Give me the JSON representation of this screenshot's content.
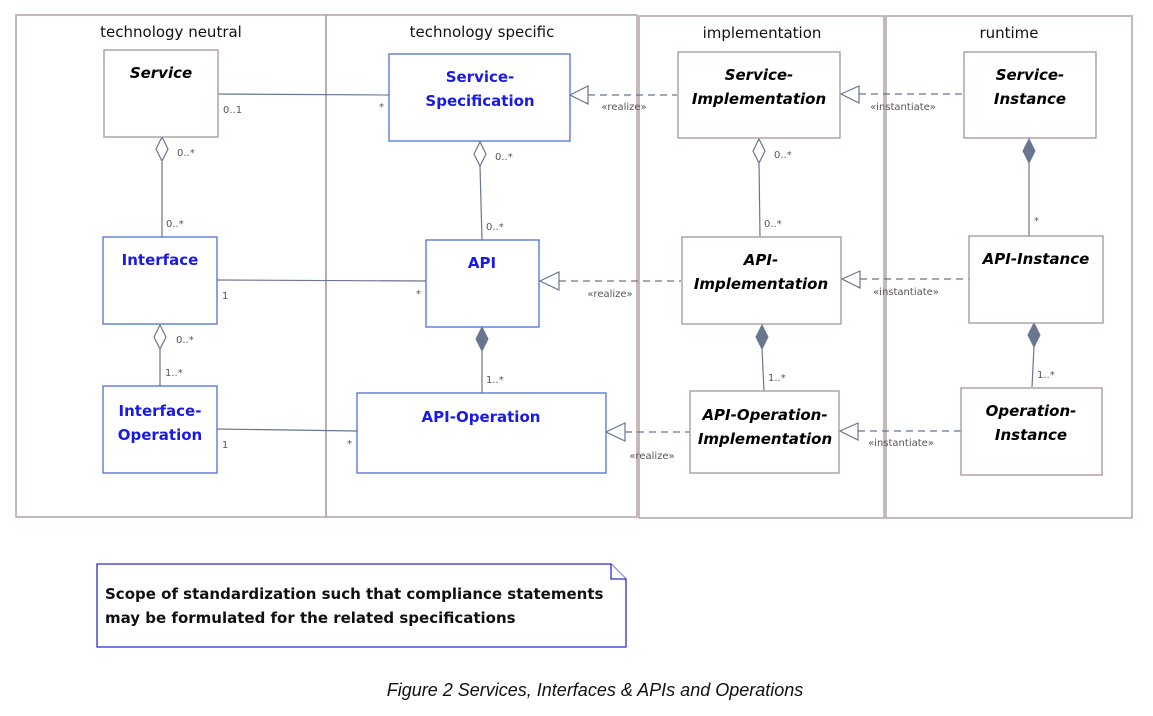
{
  "swimlanes": [
    {
      "title": "technology neutral"
    },
    {
      "title": "technology specific"
    },
    {
      "title": "implementation"
    },
    {
      "title": "runtime"
    }
  ],
  "classes": {
    "service": {
      "name_lines": [
        "Service"
      ],
      "style": "italic"
    },
    "interface": {
      "name_lines": [
        "Interface"
      ],
      "style": "blue"
    },
    "interface_operation": {
      "name_lines": [
        "Interface-",
        "Operation"
      ],
      "style": "blue"
    },
    "service_specification": {
      "name_lines": [
        "Service-",
        "Specification"
      ],
      "style": "blue"
    },
    "api": {
      "name_lines": [
        "API"
      ],
      "style": "blue"
    },
    "api_operation": {
      "name_lines": [
        "API-Operation"
      ],
      "style": "blue"
    },
    "service_implementation": {
      "name_lines": [
        "Service-",
        "Implementation"
      ],
      "style": "italic"
    },
    "api_implementation": {
      "name_lines": [
        "API-",
        "Implementation"
      ],
      "style": "italic"
    },
    "api_operation_implementation": {
      "name_lines": [
        "API-Operation-",
        "Implementation"
      ],
      "style": "italic"
    },
    "service_instance": {
      "name_lines": [
        "Service-",
        "Instance"
      ],
      "style": "italic"
    },
    "api_instance": {
      "name_lines": [
        "API-Instance"
      ],
      "style": "italic"
    },
    "operation_instance": {
      "name_lines": [
        "Operation-",
        "Instance"
      ],
      "style": "italic"
    }
  },
  "relations": {
    "service_to_spec": {
      "type": "association",
      "source_mult": "0..1",
      "target_mult": "*"
    },
    "interface_to_api": {
      "type": "association",
      "source_mult": "1",
      "target_mult": "*"
    },
    "ifop_to_apiop": {
      "type": "association",
      "source_mult": "1",
      "target_mult": "*"
    },
    "service_interface": {
      "type": "aggregation",
      "whole_mult": "0..*",
      "part_mult": "0..*"
    },
    "interface_ifop": {
      "type": "aggregation",
      "whole_mult": "0..*",
      "part_mult": "1..*"
    },
    "spec_api": {
      "type": "aggregation",
      "whole_mult": "0..*",
      "part_mult": "0..*"
    },
    "api_apiop": {
      "type": "composition",
      "part_mult": "1..*"
    },
    "simpl_apiimpl": {
      "type": "aggregation",
      "whole_mult": "0..*",
      "part_mult": "0..*"
    },
    "apiimpl_apiopimpl": {
      "type": "composition",
      "part_mult": "1..*"
    },
    "sinst_apiinst": {
      "type": "composition",
      "part_mult": "*"
    },
    "apiinst_opinst": {
      "type": "composition",
      "part_mult": "1..*"
    },
    "realize_stereotype": "«realize»",
    "instantiate_stereotype": "«instantiate»"
  },
  "note": {
    "lines": [
      "Scope of standardization such that compliance statements",
      "may be formulated for the related specifications"
    ]
  },
  "caption": "Figure 2 Services, Interfaces & APIs and Operations"
}
